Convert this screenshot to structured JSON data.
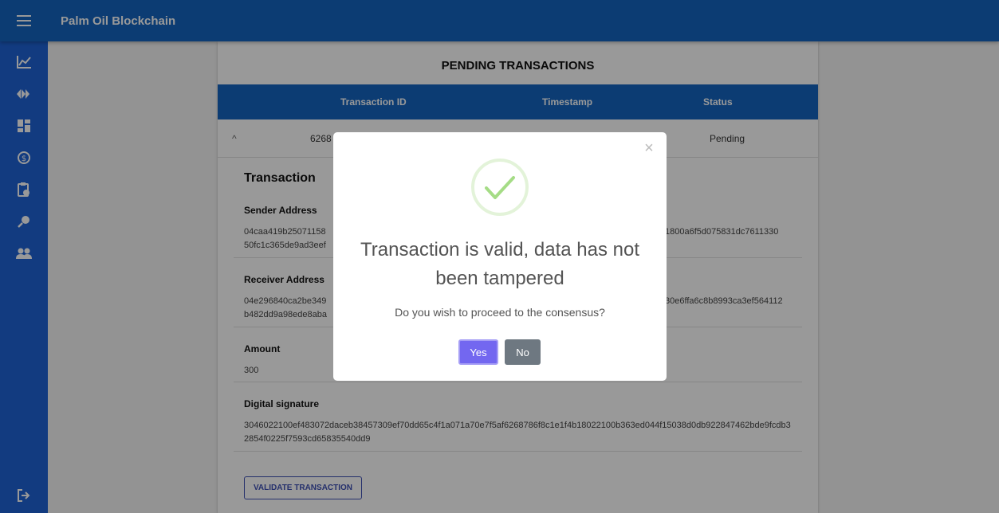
{
  "app": {
    "title": "Palm Oil Blockchain"
  },
  "sidebar": {
    "items": [
      {
        "icon": "chart-line-icon"
      },
      {
        "icon": "fast-forward-icon"
      },
      {
        "icon": "dashboard-icon"
      },
      {
        "icon": "currency-sync-icon"
      },
      {
        "icon": "clipboard-clock-icon"
      },
      {
        "icon": "magnify-icon"
      },
      {
        "icon": "people-icon"
      }
    ],
    "logout_icon": "logout-icon"
  },
  "card": {
    "title": "PENDING TRANSACTIONS",
    "columns": [
      "Transaction ID",
      "Timestamp",
      "Status"
    ],
    "row": {
      "expand_icon": "^",
      "id_partial": "6268",
      "status": "Pending"
    },
    "detail": {
      "title": "Transaction",
      "sender_label": "Sender Address",
      "sender_value_left": "04caa419b25071158",
      "sender_value_left2": "50fc1c365de9ad3eef",
      "sender_value_right": "1800a6f5d075831dc7611330",
      "receiver_label": "Receiver Address",
      "receiver_value_left": "04e296840ca2be349",
      "receiver_value_left2": "b482dd9a98ede8aba",
      "receiver_value_right": "30e6ffa6c8b8993ca3ef564112",
      "amount_label": "Amount",
      "amount_value": "300",
      "signature_label": "Digital signature",
      "signature_value": "3046022100ef483072daceb38457309ef70dd65c4f1a071a70e7f5af6268786f8c1e1f4b18022100b363ed044f15038d0db922847462bde9fcdb32854f0225f7593cd65835540dd9"
    },
    "validate_button": "VALIDATE TRANSACTION"
  },
  "modal": {
    "close": "×",
    "title": "Transaction is valid, data has not been tampered",
    "text": "Do you wish to proceed to the consensus?",
    "yes": "Yes",
    "no": "No",
    "success_color": "#a5dc86"
  }
}
